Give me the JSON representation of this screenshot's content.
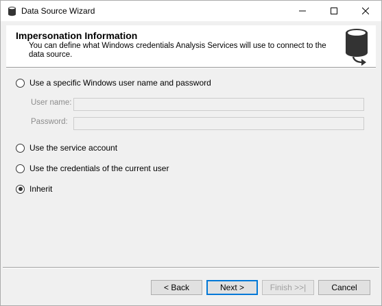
{
  "window": {
    "title": "Data Source Wizard",
    "minimize_icon": "minimize-icon",
    "maximize_icon": "maximize-icon",
    "close_icon": "close-icon"
  },
  "header": {
    "title": "Impersonation Information",
    "description": "You can define what Windows credentials Analysis Services will use to connect to the data source.",
    "icon": "database-arrow-icon"
  },
  "options": {
    "specific_user": {
      "label": "Use a specific Windows user name and password",
      "selected": false
    },
    "service_account": {
      "label": "Use the service account",
      "selected": false
    },
    "current_user": {
      "label": "Use the credentials of the current user",
      "selected": false
    },
    "inherit": {
      "label": "Inherit",
      "selected": true
    }
  },
  "fields": {
    "username_label": "User name:",
    "username_value": "",
    "password_label": "Password:",
    "password_value": ""
  },
  "buttons": {
    "back": "< Back",
    "next": "Next >",
    "finish": "Finish >>|",
    "cancel": "Cancel"
  },
  "colors": {
    "accent": "#0078d7",
    "window_bg": "#f0f0f0",
    "header_bg": "#ffffff",
    "icon_dark": "#333333"
  }
}
